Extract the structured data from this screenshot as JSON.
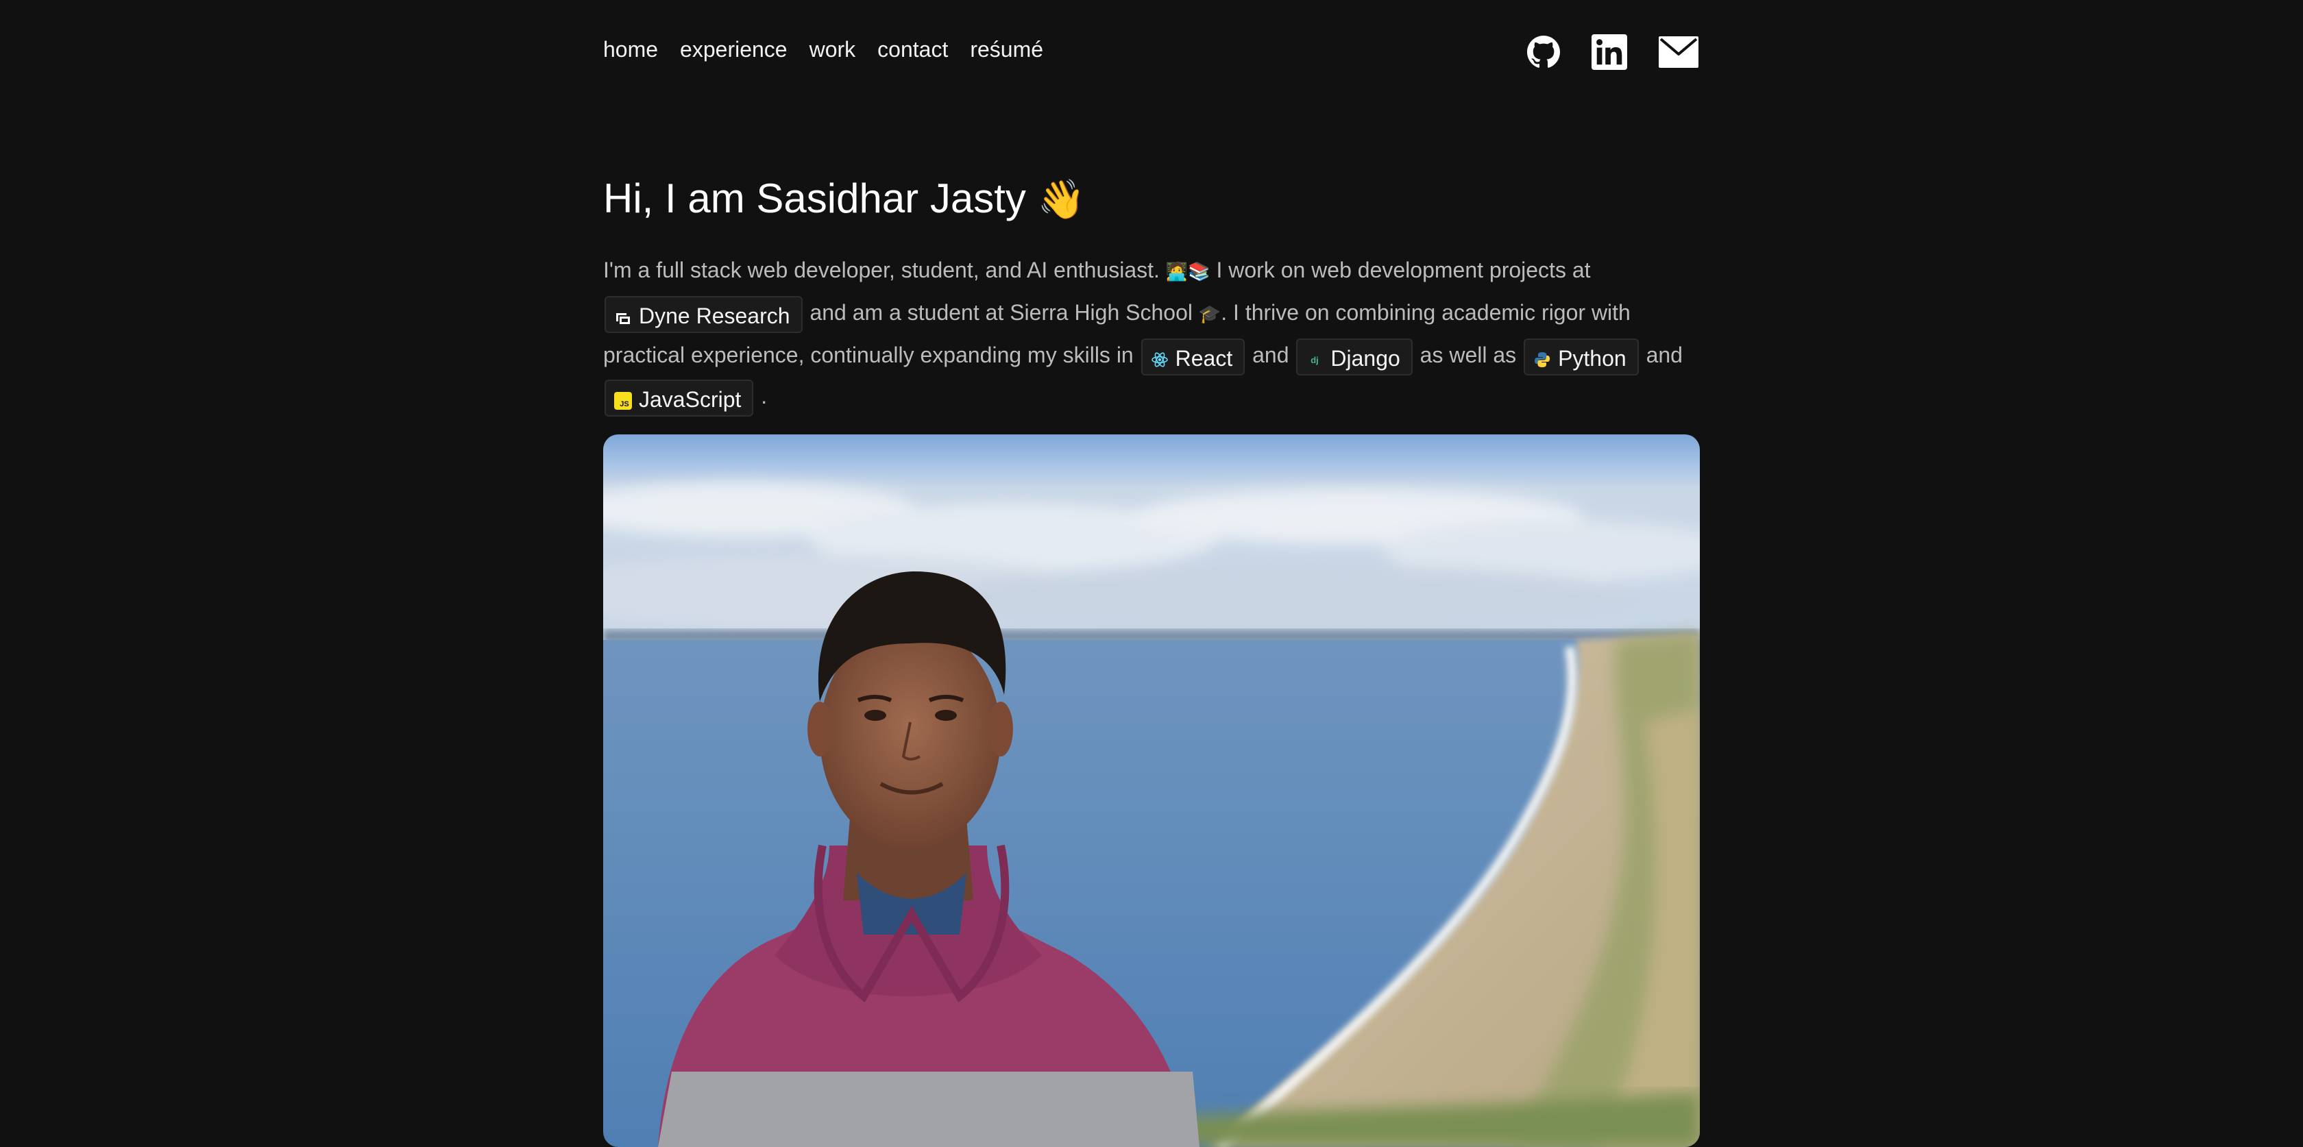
{
  "nav": {
    "items": [
      {
        "label": "home"
      },
      {
        "label": "experience"
      },
      {
        "label": "work"
      },
      {
        "label": "contact"
      },
      {
        "label": "reśumé"
      }
    ]
  },
  "socials": [
    {
      "icon": "github-icon"
    },
    {
      "icon": "linkedin-icon"
    },
    {
      "icon": "mail-icon"
    }
  ],
  "hero": {
    "title": "Hi, I am Sasidhar Jasty",
    "wave_emoji": "👋"
  },
  "intro": {
    "t1": "I'm a full stack web developer, student, and AI enthusiast.",
    "emoji_student": "🧑‍💻📚",
    "t2": "I work on web development projects at",
    "company_chip": "Dyne Research",
    "t3": "and am a student at Sierra High School",
    "emoji_grad": "🎓",
    "t4": ". I thrive on combining academic rigor with practical experience, continually expanding my skills in",
    "chip_react": "React",
    "t5": "and",
    "chip_django": "Django",
    "t6": "as well as",
    "chip_python": "Python",
    "t7": "and",
    "chip_js": "JavaScript",
    "t8": "."
  },
  "photo": {
    "subject": "portrait-photo"
  },
  "colors": {
    "background": "#111111",
    "text": "#bcbcbc",
    "chip_bg": "#1b1b1b",
    "chip_border": "#2d2d2d",
    "react": "#61dafb",
    "python_blue": "#3776ab",
    "python_yellow": "#ffd43b",
    "js_yellow": "#f7df1e"
  }
}
